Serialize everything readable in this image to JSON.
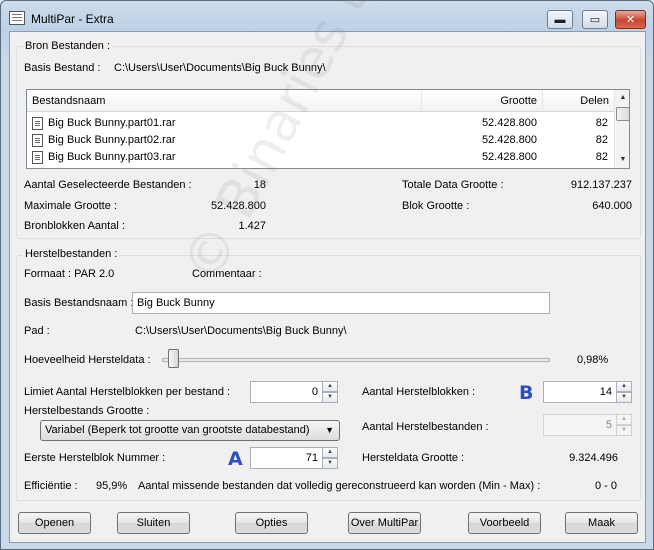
{
  "window": {
    "title": "MultiPar - Extra",
    "min_glyph": "▬",
    "max_glyph": "▭",
    "close_glyph": "✕"
  },
  "source": {
    "group_label": "Bron Bestanden :",
    "base_label": "Basis Bestand :",
    "base_value": "C:\\Users\\User\\Documents\\Big Buck Bunny\\",
    "table": {
      "headers": [
        "Bestandsnaam",
        "Grootte",
        "Delen"
      ],
      "rows": [
        {
          "name": "Big Buck Bunny.part01.rar",
          "size": "52.428.800",
          "parts": "82"
        },
        {
          "name": "Big Buck Bunny.part02.rar",
          "size": "52.428.800",
          "parts": "82"
        },
        {
          "name": "Big Buck Bunny.part03.rar",
          "size": "52.428.800",
          "parts": "82"
        }
      ]
    },
    "selected_label": "Aantal Geselecteerde Bestanden :",
    "selected_value": "18",
    "max_size_label": "Maximale Grootte :",
    "max_size_value": "52.428.800",
    "source_blocks_label": "Bronblokken Aantal :",
    "source_blocks_value": "1.427",
    "total_size_label": "Totale Data Grootte :",
    "total_size_value": "912.137.237",
    "block_size_label": "Blok Grootte :",
    "block_size_value": "640.000"
  },
  "recovery": {
    "group_label": "Herstelbestanden :",
    "format_label": "Formaat : PAR 2.0",
    "comment_label": "Commentaar :",
    "base_name_label": "Basis Bestandsnaam :",
    "base_name_value": "Big Buck Bunny",
    "path_label": "Pad :",
    "path_value": "C:\\Users\\User\\Documents\\Big Buck Bunny\\",
    "amount_label": "Hoeveelheid Hersteldata :",
    "amount_value": "0,98%",
    "amount_fraction": 0.0098,
    "limit_label": "Limiet Aantal Herstelblokken per bestand :",
    "limit_value": "0",
    "recovery_blocks_label": "Aantal Herstelblokken :",
    "recovery_blocks_value": "14",
    "file_size_label": "Herstelbestands Grootte :",
    "file_size_option": "Variabel (Beperk tot grootte van grootste databestand)",
    "recovery_files_label": "Aantal Herstelbestanden :",
    "recovery_files_value": "5",
    "first_block_label": "Eerste Herstelblok Nummer :",
    "first_block_value": "71",
    "recovery_data_size_label": "Hersteldata Grootte :",
    "recovery_data_size_value": "9.324.496",
    "efficiency_label": "Efficiëntie :",
    "efficiency_value": "95,9%",
    "missing_label": "Aantal missende bestanden dat volledig gereconstrueerd kan worden (Min - Max) :",
    "missing_value": "0 - 0"
  },
  "annotations": {
    "a": "A",
    "b": "B"
  },
  "watermark": "© Binaries tall",
  "buttons": {
    "open": "Openen",
    "close": "Sluiten",
    "options": "Opties",
    "about": "Over MultiPar",
    "preview": "Voorbeeld",
    "make": "Maak"
  }
}
